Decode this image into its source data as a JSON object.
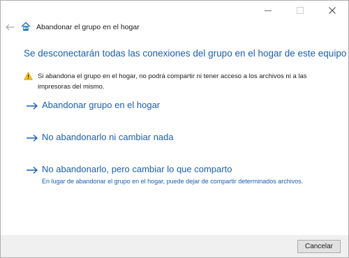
{
  "window": {
    "title": "Abandonar el grupo en el hogar",
    "controls": {
      "minimize": "minimize-icon",
      "maximize": "maximize-icon",
      "close": "close-icon"
    }
  },
  "nav": {
    "back_icon": "back-arrow-icon",
    "app_icon": "homegroup-icon"
  },
  "content": {
    "heading": "Se desconectarán todas las conexiones del grupo en el hogar de este equipo",
    "warning_icon": "warning-icon",
    "warning_text": "Si abandona el grupo en el hogar, no podrá compartir ni tener acceso a los archivos ni a las impresoras del mismo.",
    "options": [
      {
        "label": "Abandonar grupo en el hogar",
        "description": ""
      },
      {
        "label": "No abandonarlo ni cambiar nada",
        "description": ""
      },
      {
        "label": "No abandonarlo, pero cambiar lo que comparto",
        "description": "En lugar de abandonar el grupo en el hogar, puede dejar de compartir determinados archivos."
      }
    ]
  },
  "footer": {
    "cancel_label": "Cancelar"
  },
  "colors": {
    "accent": "#1a5fb0",
    "warning": "#f5c211",
    "footer_bg": "#f0f0f0",
    "button_bg": "#e1e1e1"
  }
}
